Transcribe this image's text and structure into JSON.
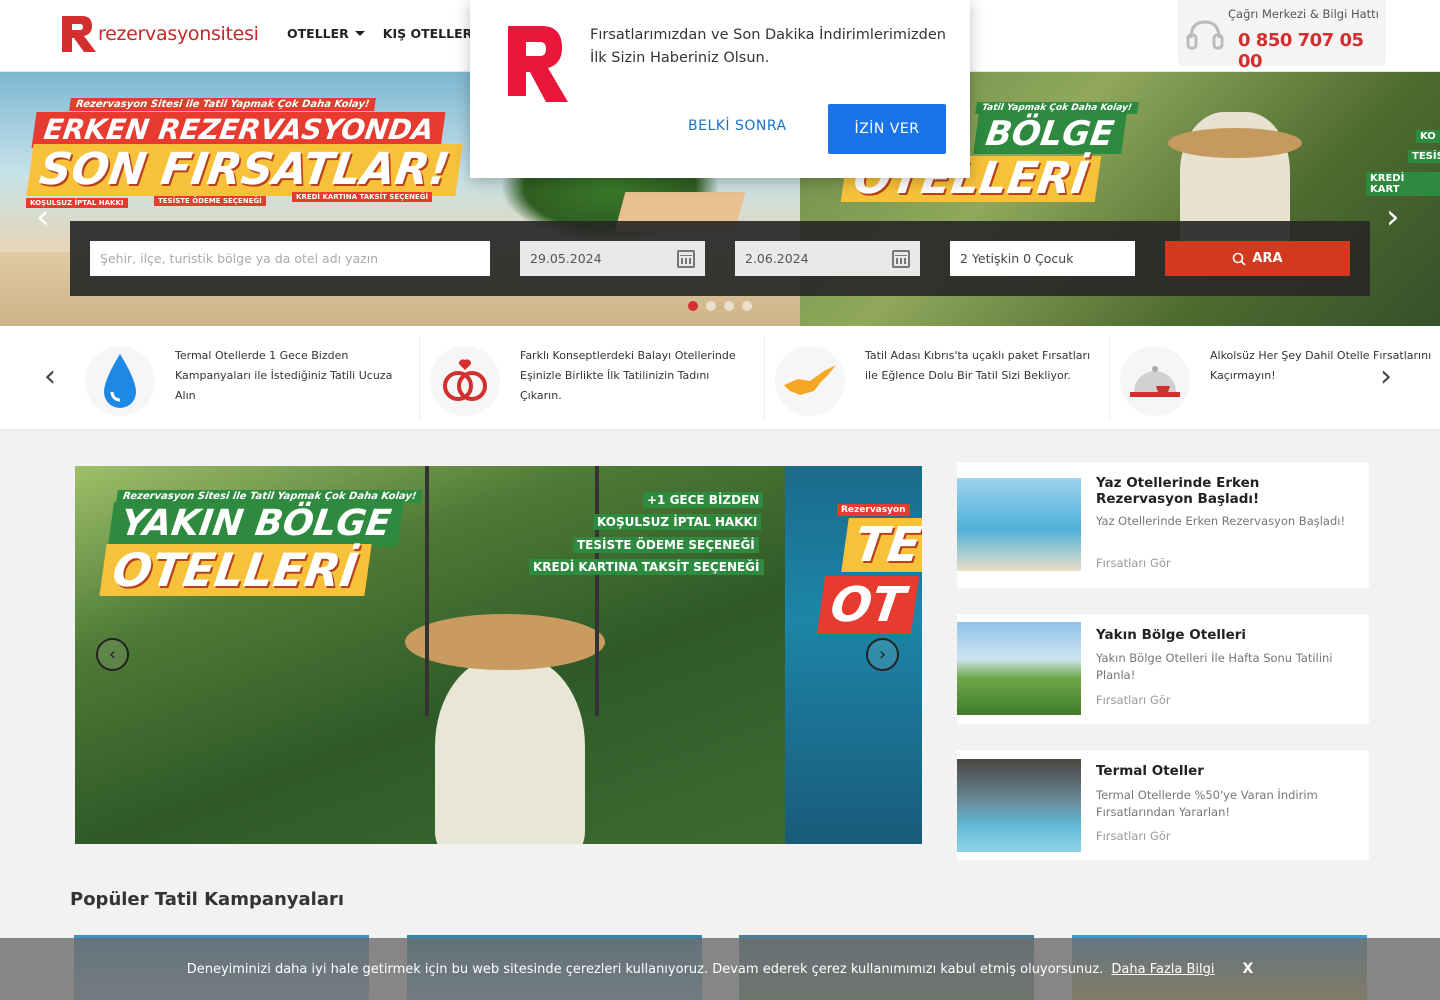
{
  "header": {
    "logo_text": "rezervasyonsitesi",
    "nav": [
      {
        "label": "OTELLER"
      },
      {
        "label": "KIŞ OTELLERİ"
      }
    ],
    "call_label": "Çağrı Merkezi & Bilgi Hattı",
    "call_number": "0 850 707 05 00"
  },
  "hero": {
    "left_tagline": "Rezervasyon Sitesi ile Tatil Yapmak Çok Daha Kolay!",
    "left_line1": "ERKEN REZERVASYONDA",
    "left_line2": "SON FIRSATLAR!",
    "left_tags": [
      "KOŞULSUZ İPTAL HAKKI",
      "TESİSTE ÖDEME SEÇENEĞİ",
      "KREDİ KARTINA TAKSİT SEÇENEĞİ"
    ],
    "right_tagline": "Tatil Yapmak Çok Daha Kolay!",
    "right_line1": "BÖLGE",
    "right_line2": "OTELLERİ",
    "right_tags": [
      "KO",
      "TESİS",
      "KREDİ KART"
    ],
    "slide_count": 4,
    "active_slide": 1
  },
  "search": {
    "destination_placeholder": "Şehir, ilçe, turistik bölge ya da otel adı yazın",
    "checkin": "29.05.2024",
    "checkout": "2.06.2024",
    "guests": "2 Yetişkin 0 Çocuk",
    "button_label": "ARA"
  },
  "features": [
    {
      "icon": "water-drop-icon",
      "text": "Termal Otellerde 1 Gece Bizden Kampanyaları ile İstediğiniz Tatili Ucuza Alın"
    },
    {
      "icon": "wedding-rings-icon",
      "text": "Farklı Konseptlerdeki Balayı Otellerinde Eşinizle Birlikte İlk Tatilinizin Tadını Çıkarın."
    },
    {
      "icon": "cyprus-map-icon",
      "text": "Tatil Adası Kıbrıs'ta uçaklı paket Fırsatları ile Eğlence Dolu Bir Tatil Sizi Bekliyor."
    },
    {
      "icon": "cloche-icon",
      "text": "Alkolsüz Her Şey Dahil Otelle Fırsatlarını Kaçırmayın!"
    }
  ],
  "main_slider": {
    "tagline": "Rezervasyon Sitesi ile Tatil Yapmak Çok Daha Kolay!",
    "line1": "YAKIN BÖLGE",
    "line2": "OTELLERİ",
    "tags": [
      "+1 GECE BİZDEN",
      "KOŞULSUZ İPTAL HAKKI",
      "TESİSTE ÖDEME SEÇENEĞİ",
      "KREDİ KARTINA TAKSİT SEÇENEĞİ"
    ],
    "side_tag": "Rezervasyon",
    "side_line1": "TE",
    "side_line2": "OT"
  },
  "campaign_cards": [
    {
      "title": "Yaz Otellerinde Erken Rezervasyon Başladı!",
      "desc": "Yaz Otellerinde Erken Rezervasyon Başladı!",
      "link": "Fırsatları Gör"
    },
    {
      "title": "Yakın Bölge Otelleri",
      "desc": "Yakın Bölge Otelleri İle Hafta Sonu Tatilini Planla!",
      "link": "Fırsatları Gör"
    },
    {
      "title": "Termal Oteller",
      "desc": "Termal Otellerde %50'ye Varan İndirim Fırsatlarından Yararlan!",
      "link": "Fırsatları Gör"
    }
  ],
  "popular_title": "Popüler Tatil Kampanyaları",
  "cookie": {
    "text": "Deneyiminizi daha iyi hale getirmek için bu web sitesinde çerezleri kullanıyoruz. Devam ederek çerez kullanımımızı kabul etmiş oluyorsunuz.",
    "link": "Daha Fazla Bilgi",
    "close": "X"
  },
  "popup": {
    "text": "Fırsatlarımızdan ve Son Dakika İndirimlerimizden İlk Sizin Haberiniz Olsun.",
    "later": "BELKİ SONRA",
    "allow": "İZİN VER"
  },
  "colors": {
    "brand_red": "#d32f2f",
    "search_button": "#d23a1f",
    "popup_button": "#1a73e8"
  }
}
